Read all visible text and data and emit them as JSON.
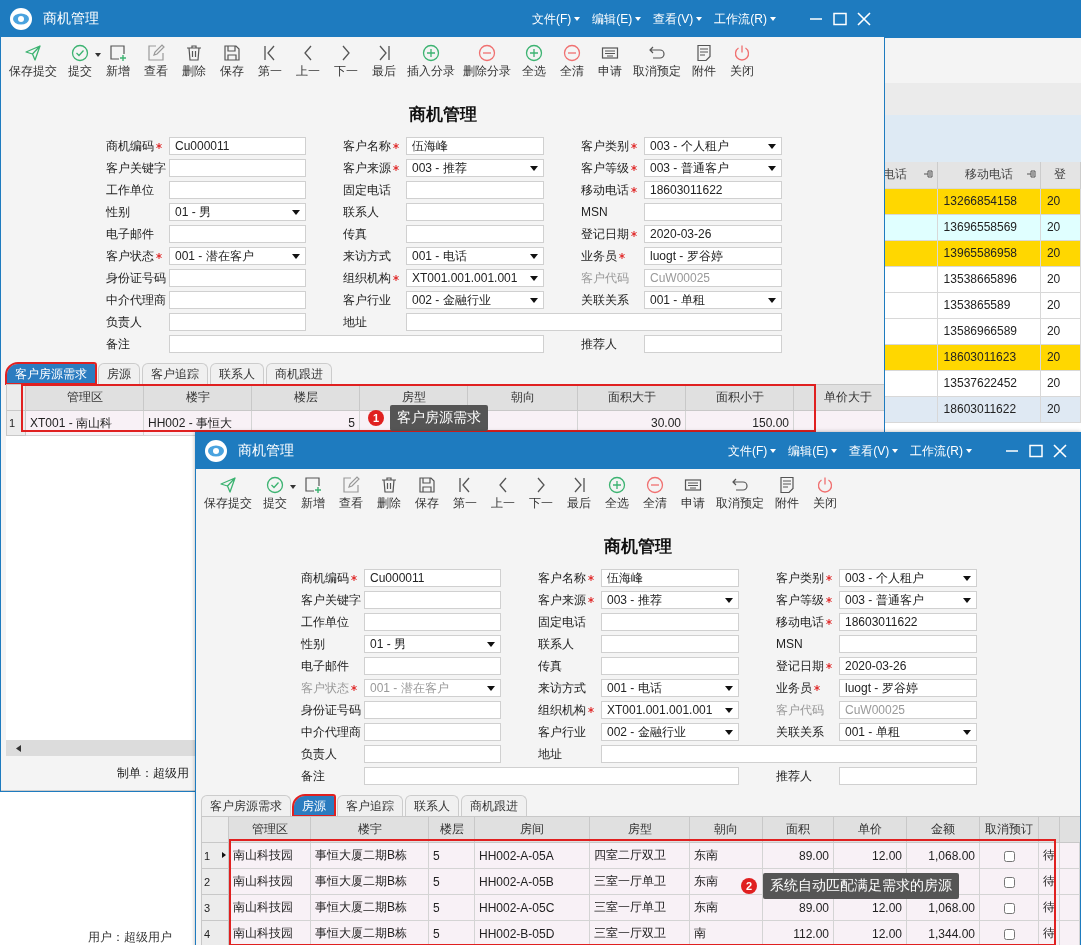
{
  "back_window": {
    "status": "用户：超级用户",
    "columns": [
      {
        "label": "电话",
        "pinned": true
      },
      {
        "label": "移动电话",
        "pinned": true
      },
      {
        "label": "登"
      }
    ],
    "rows": [
      {
        "color": "#ffd700",
        "cells": [
          null,
          "13266854158",
          "20"
        ]
      },
      {
        "color": "#e0ffff",
        "cells": [
          null,
          "13696558569",
          "20"
        ]
      },
      {
        "color": "#ffd700",
        "cells": [
          null,
          "13965586958",
          "20"
        ]
      },
      {
        "color": "#ffffff",
        "cells": [
          null,
          "13538665896",
          "20"
        ]
      },
      {
        "color": "#ffffff",
        "cells": [
          null,
          "1353865589",
          "20"
        ]
      },
      {
        "color": "#ffffff",
        "cells": [
          null,
          "13586966589",
          "20"
        ]
      },
      {
        "color": "#ffd700",
        "cells": [
          null,
          "18603011623",
          "20"
        ]
      },
      {
        "color": "#ffffff",
        "cells": [
          null,
          "13537622452",
          "20"
        ]
      },
      {
        "color": "#dfe9f3",
        "cells": [
          null,
          "18603011622",
          "20"
        ]
      }
    ]
  },
  "windows": [
    {
      "title": "商机管理",
      "menus": [
        "文件(F)",
        "编辑(E)",
        "查看(V)",
        "工作流(R)"
      ],
      "toolbar": [
        {
          "label": "保存提交",
          "kind": "send"
        },
        {
          "label": "提交",
          "kind": "check",
          "dropdown": true
        },
        {
          "label": "新增",
          "kind": "add"
        },
        {
          "label": "查看",
          "kind": "edit"
        },
        {
          "label": "删除",
          "kind": "trash"
        },
        {
          "label": "保存",
          "kind": "save"
        },
        {
          "label": "第一",
          "kind": "first"
        },
        {
          "label": "上一",
          "kind": "prev"
        },
        {
          "label": "下一",
          "kind": "next"
        },
        {
          "label": "最后",
          "kind": "last"
        },
        {
          "label": "插入分录",
          "kind": "plus"
        },
        {
          "label": "删除分录",
          "kind": "minus"
        },
        {
          "label": "全选",
          "kind": "plus"
        },
        {
          "label": "全清",
          "kind": "minus"
        },
        {
          "label": "申请",
          "kind": "keyboard"
        },
        {
          "label": "取消预定",
          "kind": "undo"
        },
        {
          "label": "附件",
          "kind": "doc"
        },
        {
          "label": "关闭",
          "kind": "power"
        }
      ],
      "heading": "商机管理",
      "form": [
        [
          {
            "label": "商机编码",
            "required": true,
            "kind": "text",
            "value": "Cu000011"
          },
          {
            "label": "客户名称",
            "required": true,
            "kind": "text",
            "value": "伍海峰"
          },
          {
            "label": "客户类别",
            "required": true,
            "kind": "select",
            "value": "003 - 个人租户"
          }
        ],
        [
          {
            "label": "客户关键字",
            "kind": "text"
          },
          {
            "label": "客户来源",
            "required": true,
            "kind": "select",
            "value": "003 - 推荐"
          },
          {
            "label": "客户等级",
            "required": true,
            "kind": "select",
            "value": "003 - 普通客户"
          }
        ],
        [
          {
            "label": "工作单位",
            "kind": "text"
          },
          {
            "label": "固定电话",
            "kind": "text"
          },
          {
            "label": "移动电话",
            "required": true,
            "kind": "text",
            "value": "18603011622"
          }
        ],
        [
          {
            "label": "性别",
            "kind": "select",
            "value": "01 - 男"
          },
          {
            "label": "联系人",
            "kind": "text"
          },
          {
            "label": "MSN",
            "kind": "text"
          }
        ],
        [
          {
            "label": "电子邮件",
            "kind": "text"
          },
          {
            "label": "传真",
            "kind": "text"
          },
          {
            "label": "登记日期",
            "required": true,
            "kind": "text",
            "value": "2020-03-26"
          }
        ],
        [
          {
            "label": "客户状态",
            "required": true,
            "kind": "select",
            "value": "001 - 潜在客户",
            "disabled": false
          },
          {
            "label": "来访方式",
            "kind": "select",
            "value": "001 - 电话"
          },
          {
            "label": "业务员",
            "required": true,
            "kind": "text",
            "value": "luogt  - 罗谷婷"
          }
        ],
        [
          {
            "label": "身份证号码",
            "kind": "text"
          },
          {
            "label": "组织机构",
            "required": true,
            "kind": "select",
            "value": "XT001.001.001.001"
          },
          {
            "label": "客户代码",
            "kind": "text",
            "value": "CuW00025",
            "disabled": true
          }
        ],
        [
          {
            "label": "中介代理商",
            "kind": "text"
          },
          {
            "label": "客户行业",
            "kind": "select",
            "value": "002 - 金融行业"
          },
          {
            "label": "关联关系",
            "kind": "select",
            "value": "001 - 单租"
          }
        ],
        [
          {
            "label": "负责人",
            "kind": "text"
          },
          {
            "label": "地址",
            "kind": "wide"
          }
        ],
        [
          {
            "label": "备注",
            "kind": "wide"
          },
          {
            "label": "推荐人",
            "kind": "text"
          }
        ]
      ],
      "tabs": [
        {
          "label": "客户房源需求",
          "selected": true
        },
        {
          "label": "房源",
          "selected": false
        },
        {
          "label": "客户追踪",
          "selected": false
        },
        {
          "label": "联系人",
          "selected": false
        },
        {
          "label": "商机跟进",
          "selected": false
        }
      ],
      "grid": {
        "columns": [
          {
            "label": "管理区",
            "kind": "text"
          },
          {
            "label": "楼宇",
            "kind": "text"
          },
          {
            "label": "楼层",
            "kind": "number"
          },
          {
            "label": "房型",
            "kind": "text"
          },
          {
            "label": "朝向",
            "kind": "text"
          },
          {
            "label": "面积大于",
            "kind": "number"
          },
          {
            "label": "面积小于",
            "kind": "number"
          },
          {
            "label": "单价大于",
            "kind": "number"
          }
        ],
        "rows": [
          {
            "number": "1",
            "cells": [
              "XT001  - 南山科",
              "HH002 - 事恒大",
              "5",
              null,
              null,
              "30.00",
              "150.00",
              null
            ]
          }
        ]
      },
      "callout": {
        "number": "1",
        "text": "客户房源需求"
      },
      "footer": "制单：超级用"
    },
    {
      "title": "商机管理",
      "menus": [
        "文件(F)",
        "编辑(E)",
        "查看(V)",
        "工作流(R)"
      ],
      "toolbar": [
        {
          "label": "保存提交",
          "kind": "send"
        },
        {
          "label": "提交",
          "kind": "check",
          "dropdown": true
        },
        {
          "label": "新增",
          "kind": "add"
        },
        {
          "label": "查看",
          "kind": "edit"
        },
        {
          "label": "删除",
          "kind": "trash"
        },
        {
          "label": "保存",
          "kind": "save"
        },
        {
          "label": "第一",
          "kind": "first"
        },
        {
          "label": "上一",
          "kind": "prev"
        },
        {
          "label": "下一",
          "kind": "next"
        },
        {
          "label": "最后",
          "kind": "last"
        },
        {
          "label": "全选",
          "kind": "plus"
        },
        {
          "label": "全清",
          "kind": "minus"
        },
        {
          "label": "申请",
          "kind": "keyboard"
        },
        {
          "label": "取消预定",
          "kind": "undo"
        },
        {
          "label": "附件",
          "kind": "doc"
        },
        {
          "label": "关闭",
          "kind": "power"
        }
      ],
      "heading": "商机管理",
      "form": [
        [
          {
            "label": "商机编码",
            "required": true,
            "kind": "text",
            "value": "Cu000011"
          },
          {
            "label": "客户名称",
            "required": true,
            "kind": "text",
            "value": "伍海峰"
          },
          {
            "label": "客户类别",
            "required": true,
            "kind": "select",
            "value": "003 - 个人租户"
          }
        ],
        [
          {
            "label": "客户关键字",
            "kind": "text"
          },
          {
            "label": "客户来源",
            "required": true,
            "kind": "select",
            "value": "003 - 推荐"
          },
          {
            "label": "客户等级",
            "required": true,
            "kind": "select",
            "value": "003 - 普通客户"
          }
        ],
        [
          {
            "label": "工作单位",
            "kind": "text"
          },
          {
            "label": "固定电话",
            "kind": "text"
          },
          {
            "label": "移动电话",
            "required": true,
            "kind": "text",
            "value": "18603011622"
          }
        ],
        [
          {
            "label": "性别",
            "kind": "select",
            "value": "01 - 男"
          },
          {
            "label": "联系人",
            "kind": "text"
          },
          {
            "label": "MSN",
            "kind": "text"
          }
        ],
        [
          {
            "label": "电子邮件",
            "kind": "text"
          },
          {
            "label": "传真",
            "kind": "text"
          },
          {
            "label": "登记日期",
            "required": true,
            "kind": "text",
            "value": "2020-03-26"
          }
        ],
        [
          {
            "label": "客户状态",
            "required": true,
            "kind": "select",
            "value": "001 - 潜在客户",
            "disabled": true
          },
          {
            "label": "来访方式",
            "kind": "select",
            "value": "001 - 电话"
          },
          {
            "label": "业务员",
            "required": true,
            "kind": "text",
            "value": "luogt  - 罗谷婷"
          }
        ],
        [
          {
            "label": "身份证号码",
            "kind": "text"
          },
          {
            "label": "组织机构",
            "required": true,
            "kind": "select",
            "value": "XT001.001.001.001"
          },
          {
            "label": "客户代码",
            "kind": "text",
            "value": "CuW00025",
            "disabled": true
          }
        ],
        [
          {
            "label": "中介代理商",
            "kind": "text"
          },
          {
            "label": "客户行业",
            "kind": "select",
            "value": "002 - 金融行业"
          },
          {
            "label": "关联关系",
            "kind": "select",
            "value": "001 - 单租"
          }
        ],
        [
          {
            "label": "负责人",
            "kind": "text"
          },
          {
            "label": "地址",
            "kind": "wide"
          }
        ],
        [
          {
            "label": "备注",
            "kind": "wide"
          },
          {
            "label": "推荐人",
            "kind": "text"
          }
        ]
      ],
      "tabs": [
        {
          "label": "客户房源需求",
          "selected": false
        },
        {
          "label": "房源",
          "selected": true
        },
        {
          "label": "客户追踪",
          "selected": false
        },
        {
          "label": "联系人",
          "selected": false
        },
        {
          "label": "商机跟进",
          "selected": false
        }
      ],
      "grid": {
        "columns": [
          {
            "label": "管理区",
            "kind": "text"
          },
          {
            "label": "楼宇",
            "kind": "text"
          },
          {
            "label": "楼层",
            "kind": "text"
          },
          {
            "label": "房间",
            "kind": "text"
          },
          {
            "label": "房型",
            "kind": "text"
          },
          {
            "label": "朝向",
            "kind": "text"
          },
          {
            "label": "面积",
            "kind": "number"
          },
          {
            "label": "单价",
            "kind": "number"
          },
          {
            "label": "金额",
            "kind": "number"
          },
          {
            "label": "取消预订",
            "kind": "check"
          },
          {
            "kind": "text"
          }
        ],
        "rows": [
          {
            "number": "1",
            "current": true,
            "cells": [
              "南山科技园",
              "事恒大厦二期B栋",
              "5",
              "HH002-A-05A",
              "四室二厅双卫",
              "东南",
              "89.00",
              "12.00",
              "1,068.00",
              false,
              "待"
            ]
          },
          {
            "number": "2",
            "current": false,
            "cells": [
              "南山科技园",
              "事恒大厦二期B栋",
              "5",
              "HH002-A-05B",
              "三室一厅单卫",
              "东南",
              null,
              null,
              null,
              false,
              "待"
            ]
          },
          {
            "number": "3",
            "current": false,
            "cells": [
              "南山科技园",
              "事恒大厦二期B栋",
              "5",
              "HH002-A-05C",
              "三室一厅单卫",
              "东南",
              "89.00",
              "12.00",
              "1,068.00",
              false,
              "待"
            ]
          },
          {
            "number": "4",
            "current": false,
            "cells": [
              "南山科技园",
              "事恒大厦二期B栋",
              "5",
              "HH002-B-05D",
              "三室一厅双卫",
              "南",
              "112.00",
              "12.00",
              "1,344.00",
              false,
              "待"
            ]
          }
        ]
      },
      "callout": {
        "number": "2",
        "text": "系统自动匹配满足需求的房源"
      }
    }
  ]
}
